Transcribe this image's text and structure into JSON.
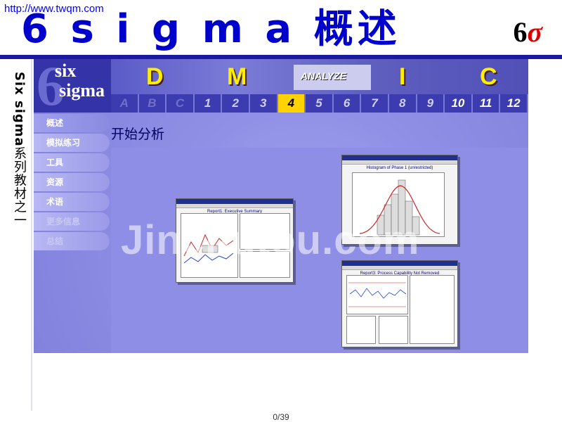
{
  "header": {
    "url": "http://www.twqm.com",
    "title": "6 s i g m a 概述",
    "logo_digit": "6",
    "logo_symbol": "σ"
  },
  "side_text": {
    "latin": "Six sigma",
    "cn": "系列教材之一"
  },
  "app": {
    "logo_top": "six",
    "logo_bottom": "sigma",
    "phases": [
      "D",
      "M",
      "ANALYZE",
      "I",
      "C"
    ],
    "steps": [
      "A",
      "B",
      "C",
      "1",
      "2",
      "3",
      "4",
      "5",
      "6",
      "7",
      "8",
      "9",
      "10",
      "11",
      "12"
    ],
    "active_step": "4",
    "menu": [
      {
        "label": "概述"
      },
      {
        "label": "模拟练习"
      },
      {
        "label": "工具"
      },
      {
        "label": "资源"
      },
      {
        "label": "术语"
      },
      {
        "label": "更多信息"
      },
      {
        "label": "总结"
      }
    ],
    "page_heading": "开始分析"
  },
  "screenshots": {
    "left_caption": "Report1: Executive Summary",
    "top_right_caption": "Histogram of Phase 1 (unrestricted)",
    "bottom_right_caption": "Report3: Process Capability Not Removed"
  },
  "watermark": "Jinchutou.com",
  "footer": {
    "page": "0/39"
  }
}
